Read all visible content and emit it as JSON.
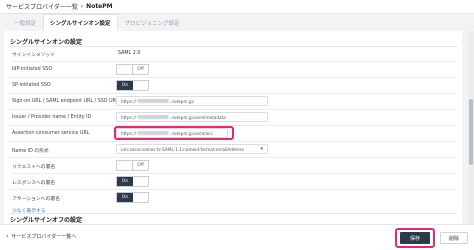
{
  "header": {
    "breadcrumb": "サービスプロバイダー一覧",
    "separator": "›",
    "app_name": "NotePM"
  },
  "tabs": [
    {
      "label": "一般設定",
      "active": false
    },
    {
      "label": "シングルサインオン設定",
      "active": true
    },
    {
      "label": "プロビジョニング設定",
      "active": false
    }
  ],
  "sso_section": {
    "title": "シングルサインオンの設定",
    "rows": {
      "signin_method": {
        "label": "サインインメソッド",
        "value": "SAML 2.0"
      },
      "idp_initiated": {
        "label": "IdP-initiated SSO",
        "state": "Off"
      },
      "sp_initiated": {
        "label": "SP-initiated SSO",
        "state": "On"
      },
      "sign_on_url": {
        "label": "Sign-on URL / SAML endpoint URL / SSO URL",
        "prefix": "https://",
        "suffix": ".notepm.jp/"
      },
      "issuer": {
        "label": "Issuer / Provider name / Entity ID",
        "prefix": "https://",
        "suffix": ".notepm.jp/saml/metadata"
      },
      "acs_url": {
        "label": "Assertion consumer service URL",
        "prefix": "https://",
        "suffix": ".notepm.jp/saml/acs"
      },
      "name_id": {
        "label": "Name ID の形式",
        "value": "urn:oasis:names:tc:SAML:1.1:nameid-format:emailAddress"
      },
      "request_signed": {
        "label": "リクエストへの署名",
        "state": "Off"
      },
      "response_signed": {
        "label": "レスポンスへの署名",
        "state": "On"
      },
      "assertion_signed": {
        "label": "アサーションへの署名",
        "state": "On"
      }
    },
    "show_less": "少なく表示する"
  },
  "slo_section": {
    "title": "シングルサインオフの設定"
  },
  "footer": {
    "back_label": "サービスプロバイダー一覧へ",
    "save_label": "保存",
    "delete_label": "削除"
  },
  "colors": {
    "accent_dark": "#2b3a4d",
    "highlight": "#e5296f",
    "link": "#2a6fcf"
  }
}
